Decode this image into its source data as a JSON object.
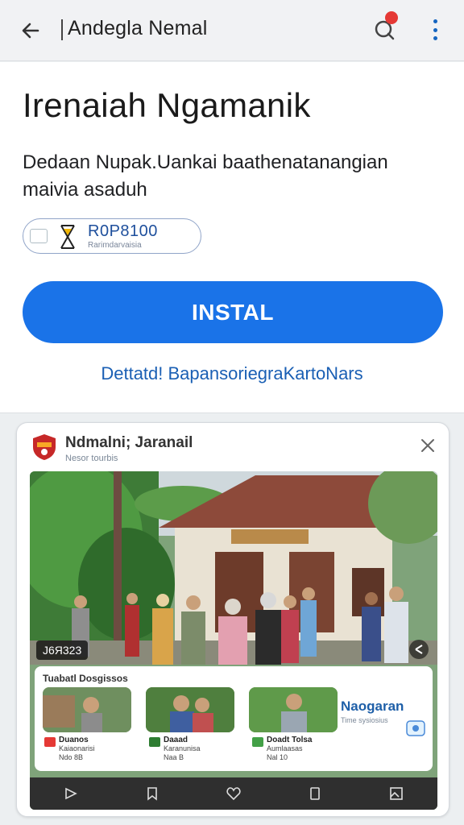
{
  "appbar": {
    "title": "Andegla Nemal",
    "back_icon": "arrow-left-icon",
    "notification_icon": "notification-icon",
    "notification_count": "",
    "more_icon": "more-vert-icon"
  },
  "app": {
    "name": "Irenaiah Ngamanik",
    "description": "Dedaan Nupak.Uankai baathenatanangian maivia asaduh",
    "pill_code": "R0P8100",
    "pill_sub": "Rarimdarvaisia",
    "install_label": "INSTAL",
    "link_text": "Dettatd! BapansoriegraKartoNars"
  },
  "card": {
    "title": "Ndmalni; Jaranail",
    "subtitle": "Nesor tourbis",
    "close_icon": "close-icon",
    "badge": "J6Я323",
    "overlay_title": "Tuabatl Dosgissos",
    "thumbs": [
      {
        "title": "Duanos",
        "line1": "Kaiaonarisi",
        "line2": "Ndo 8B"
      },
      {
        "title": "Daaad",
        "line1": "Karanunisa",
        "line2": "Naa B"
      },
      {
        "title": "Doadt Tolsa",
        "line1": "Aumlaasas",
        "line2": "Nal 10"
      }
    ],
    "right_title": "Naogaran",
    "right_sub": "Time sysiosius"
  },
  "colors": {
    "accent": "#1a73e8",
    "link": "#1a5fb4",
    "appbar_bg": "#f1f2f4"
  }
}
